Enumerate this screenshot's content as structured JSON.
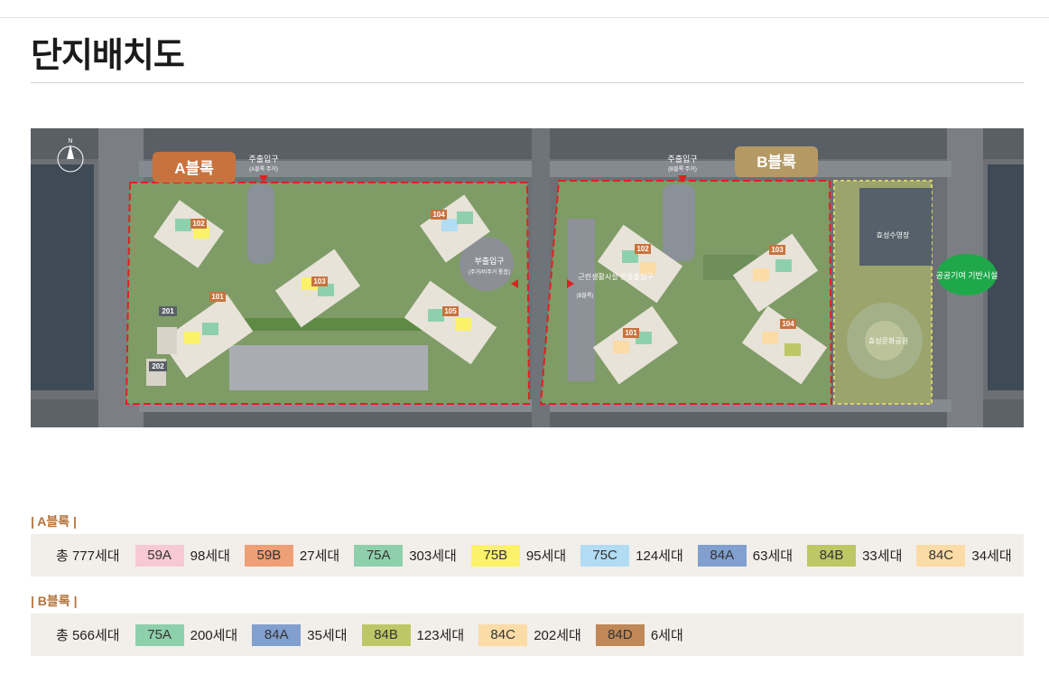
{
  "title": "단지배치도",
  "site_plan": {
    "block_a_label": "A블록",
    "block_b_label": "B블록",
    "a_main_entrance": "주출입구",
    "a_main_entrance_sub": "(A블록 주거)",
    "b_main_entrance": "주출입구",
    "b_main_entrance_sub": "(B블록 주거)",
    "a_sub_entrance": "부출입구",
    "a_sub_entrance_sub": "(주거/비주거 통합)",
    "b_sub_entrance": "근린생활시설 전용출입구",
    "b_sub_entrance_sub": "(B블록)",
    "public_facility": "공공기여 기반시설",
    "stadium": "효성수영장",
    "park": "효성문화공원",
    "a_buildings": [
      "101",
      "102",
      "103",
      "104",
      "105",
      "201",
      "202"
    ],
    "b_buildings": [
      "101",
      "102",
      "103",
      "104"
    ]
  },
  "block_a": {
    "heading": "| A블록 |",
    "total": "총 777세대",
    "items": [
      {
        "type": "59A",
        "count": "98세대",
        "color": "#f7c9d4"
      },
      {
        "type": "59B",
        "count": "27세대",
        "color": "#ee9f76"
      },
      {
        "type": "75A",
        "count": "303세대",
        "color": "#8fd0ac"
      },
      {
        "type": "75B",
        "count": "95세대",
        "color": "#fbf26a"
      },
      {
        "type": "75C",
        "count": "124세대",
        "color": "#b2dcf3"
      },
      {
        "type": "84A",
        "count": "63세대",
        "color": "#819fcf"
      },
      {
        "type": "84B",
        "count": "33세대",
        "color": "#bec766"
      },
      {
        "type": "84C",
        "count": "34세대",
        "color": "#fbdba6"
      }
    ]
  },
  "block_b": {
    "heading": "| B블록 |",
    "total": "총 566세대",
    "items": [
      {
        "type": "75A",
        "count": "200세대",
        "color": "#8fd0ac"
      },
      {
        "type": "84A",
        "count": "35세대",
        "color": "#819fcf"
      },
      {
        "type": "84B",
        "count": "123세대",
        "color": "#bec766"
      },
      {
        "type": "84C",
        "count": "202세대",
        "color": "#fbdba6"
      },
      {
        "type": "84D",
        "count": "6세대",
        "color": "#c08856"
      }
    ]
  },
  "colors": {
    "accent": "#b3733b",
    "legend_bg": "#f2efea",
    "boundary": "#e02020"
  }
}
